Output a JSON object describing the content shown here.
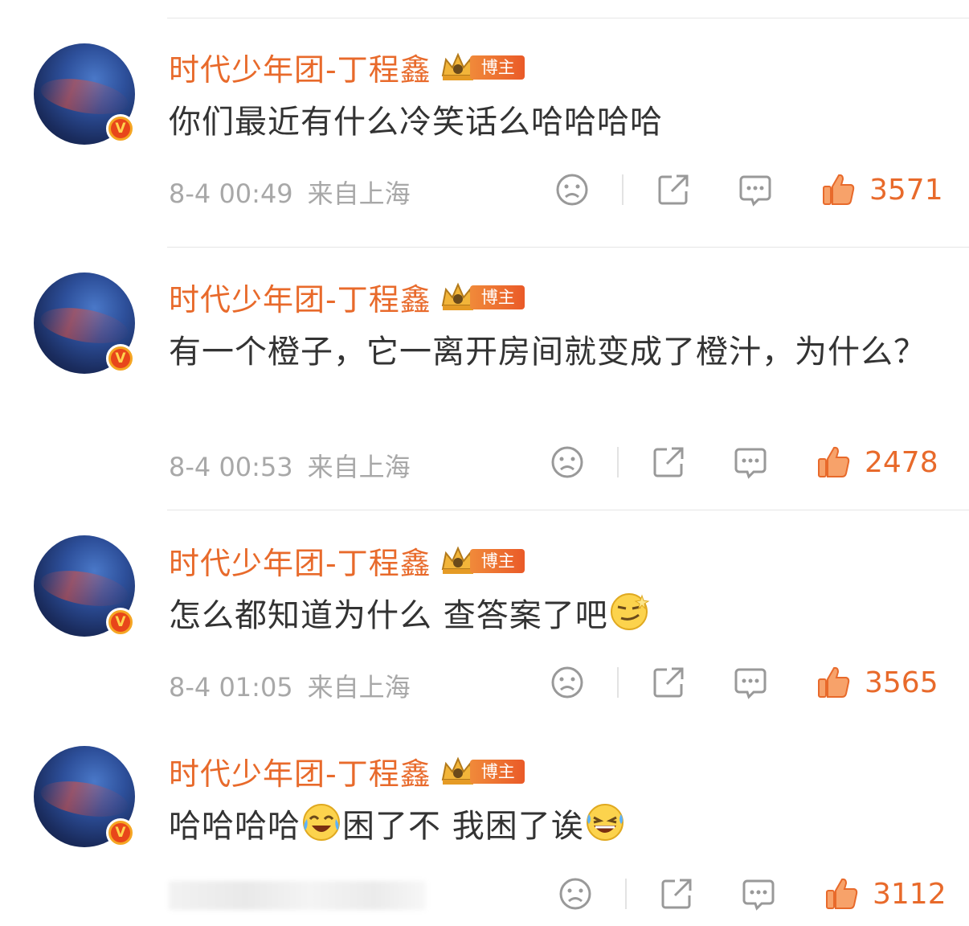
{
  "comments": [
    {
      "author": "时代少年团-丁程鑫",
      "badge_label": "博主",
      "text": "你们最近有什么冷笑话么哈哈哈哈",
      "emojis": [],
      "time": "8-4 00:49",
      "location": "来自上海",
      "likes": "3571"
    },
    {
      "author": "时代少年团-丁程鑫",
      "badge_label": "博主",
      "text": "有一个橙子，它一离开房间就变成了橙汁，为什么？",
      "emojis": [],
      "time": "8-4 00:53",
      "location": "来自上海",
      "likes": "2478"
    },
    {
      "author": "时代少年团-丁程鑫",
      "badge_label": "博主",
      "text_parts": [
        "怎么都知道为什么 查答案了吧"
      ],
      "emojis": [
        "smirk-emoji"
      ],
      "time": "8-4 01:05",
      "location": "来自上海",
      "likes": "3565"
    },
    {
      "author": "时代少年团-丁程鑫",
      "badge_label": "博主",
      "text_parts": [
        "哈哈哈哈",
        "困了不 我困了诶"
      ],
      "emojis": [
        "crying-laughing-emoji",
        "laughing-emoji"
      ],
      "time": "",
      "location": "",
      "likes": "3112"
    }
  ],
  "icons": [
    "sad-face-icon",
    "share-icon",
    "comment-icon",
    "thumbs-up-icon",
    "verified-v-icon",
    "crown-icon"
  ],
  "colors": {
    "accent": "#e86a2b",
    "text": "#333333",
    "meta": "#a8a8a8",
    "divider": "#e6e6e6"
  }
}
